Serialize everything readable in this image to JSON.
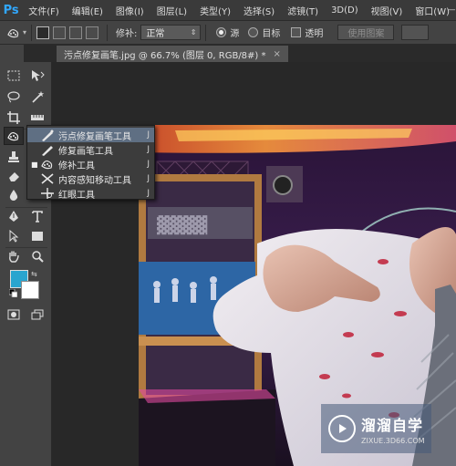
{
  "app": {
    "logo_text": "Ps"
  },
  "menu": {
    "items": [
      "文件(F)",
      "编辑(E)",
      "图像(I)",
      "图层(L)",
      "类型(Y)",
      "选择(S)",
      "滤镜(T)",
      "3D(D)",
      "视图(V)",
      "窗口(W)"
    ]
  },
  "window_controls": {
    "minimize": "—",
    "maximize": "□",
    "close": "✕"
  },
  "options": {
    "patch_label": "修补:",
    "patch_mode_value": "正常",
    "source_label": "源",
    "target_label": "目标",
    "transparent_label": "透明",
    "use_pattern_label": "使用图案"
  },
  "document": {
    "tab_title": "污点修复画笔.jpg @ 66.7% (图层 0, RGB/8#) *",
    "close_glyph": "×"
  },
  "flyout": {
    "items": [
      {
        "label": "污点修复画笔工具",
        "key": "J",
        "selected": true,
        "current": false,
        "icon": "spot-healing-brush-icon"
      },
      {
        "label": "修复画笔工具",
        "key": "J",
        "selected": false,
        "current": false,
        "icon": "healing-brush-icon"
      },
      {
        "label": "修补工具",
        "key": "J",
        "selected": false,
        "current": true,
        "icon": "patch-icon"
      },
      {
        "label": "内容感知移动工具",
        "key": "J",
        "selected": false,
        "current": false,
        "icon": "content-aware-move-icon"
      },
      {
        "label": "红眼工具",
        "key": "J",
        "selected": false,
        "current": false,
        "icon": "red-eye-icon"
      }
    ],
    "bullet": "■"
  },
  "colors": {
    "foreground": "#2aa5cf",
    "background": "#ffffff",
    "accent": "#31a8ff"
  },
  "watermark": {
    "title": "溜溜自学",
    "url": "ZIXUE.3D66.COM"
  }
}
